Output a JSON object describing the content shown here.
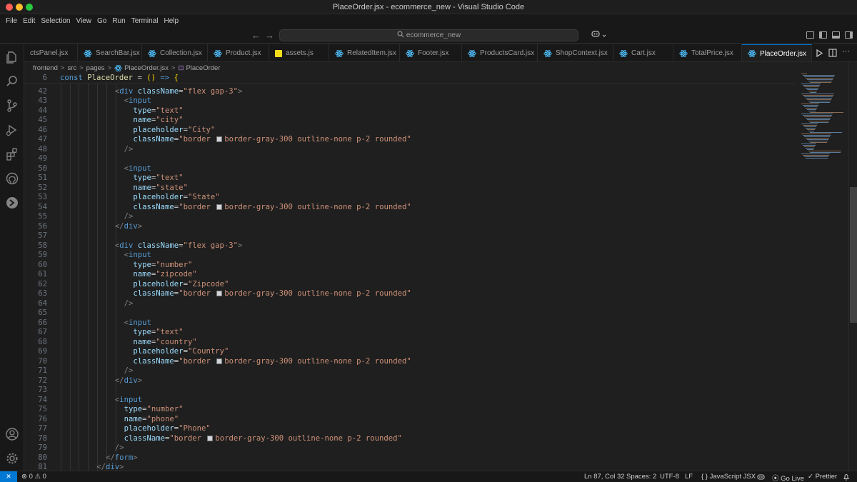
{
  "window": {
    "title": "PlaceOrder.jsx - ecommerce_new - Visual Studio Code"
  },
  "menu": [
    "File",
    "Edit",
    "Selection",
    "View",
    "Go",
    "Run",
    "Terminal",
    "Help"
  ],
  "command_center": {
    "label": "ecommerce_new",
    "back": "←",
    "forward": "→"
  },
  "tabs": [
    {
      "label": "ctsPanel.jsx",
      "icon": "react-icon"
    },
    {
      "label": "SearchBar.jsx",
      "icon": "react-icon"
    },
    {
      "label": "Collection.jsx",
      "icon": "react-icon"
    },
    {
      "label": "Product.jsx",
      "icon": "react-icon"
    },
    {
      "label": "assets.js",
      "icon": "js-icon"
    },
    {
      "label": "RelatedItem.jsx",
      "icon": "react-icon"
    },
    {
      "label": "Footer.jsx",
      "icon": "react-icon"
    },
    {
      "label": "ProductsCard.jsx",
      "icon": "react-icon"
    },
    {
      "label": "ShopContext.jsx",
      "icon": "react-icon"
    },
    {
      "label": "Cart.jsx",
      "icon": "react-icon"
    },
    {
      "label": "TotalPrice.jsx",
      "icon": "react-icon"
    },
    {
      "label": "PlaceOrder.jsx",
      "icon": "react-icon",
      "active": true,
      "close": "✕"
    }
  ],
  "breadcrumb": [
    "frontend",
    "src",
    "pages",
    "PlaceOrder.jsx",
    "PlaceOrder"
  ],
  "editor": {
    "sticky_line": {
      "number": "6",
      "tokens": [
        [
          "kw",
          "const "
        ],
        [
          "fn",
          "PlaceOrder"
        ],
        [
          "",
          "  = "
        ],
        [
          "brace",
          "()"
        ],
        [
          "kw",
          " =>"
        ],
        [
          "brace",
          " {"
        ]
      ]
    },
    "lines": [
      {
        "n": "42",
        "indent": 6,
        "tokens": [
          [
            "punc",
            "<"
          ],
          [
            "tag",
            "div"
          ],
          [
            "attr",
            " className"
          ],
          [
            "",
            "="
          ],
          [
            "str",
            "\"flex gap-3\""
          ],
          [
            "punc",
            ">"
          ]
        ]
      },
      {
        "n": "43",
        "indent": 7,
        "tokens": [
          [
            "punc",
            "<"
          ],
          [
            "tag",
            "input"
          ]
        ]
      },
      {
        "n": "44",
        "indent": 8,
        "tokens": [
          [
            "attr",
            "type"
          ],
          [
            "",
            "="
          ],
          [
            "str",
            "\"text\""
          ]
        ]
      },
      {
        "n": "45",
        "indent": 8,
        "tokens": [
          [
            "attr",
            "name"
          ],
          [
            "",
            "="
          ],
          [
            "str",
            "\"city\""
          ]
        ]
      },
      {
        "n": "46",
        "indent": 8,
        "tokens": [
          [
            "attr",
            "placeholder"
          ],
          [
            "",
            "="
          ],
          [
            "str",
            "\"City\""
          ]
        ]
      },
      {
        "n": "47",
        "indent": 8,
        "tokens": [
          [
            "attr",
            "className"
          ],
          [
            "",
            "="
          ],
          [
            "str",
            "\"border "
          ],
          [
            "swatch",
            ""
          ],
          [
            "str",
            "border-gray-300 outline-none p-2 rounded\""
          ]
        ]
      },
      {
        "n": "48",
        "indent": 7,
        "tokens": [
          [
            "punc",
            "/>"
          ]
        ]
      },
      {
        "n": "49",
        "indent": 0,
        "tokens": []
      },
      {
        "n": "50",
        "indent": 7,
        "tokens": [
          [
            "punc",
            "<"
          ],
          [
            "tag",
            "input"
          ]
        ]
      },
      {
        "n": "51",
        "indent": 8,
        "tokens": [
          [
            "attr",
            "type"
          ],
          [
            "",
            "="
          ],
          [
            "str",
            "\"text\""
          ]
        ]
      },
      {
        "n": "52",
        "indent": 8,
        "tokens": [
          [
            "attr",
            "name"
          ],
          [
            "",
            "="
          ],
          [
            "str",
            "\"state\""
          ]
        ]
      },
      {
        "n": "53",
        "indent": 8,
        "tokens": [
          [
            "attr",
            "placeholder"
          ],
          [
            "",
            "="
          ],
          [
            "str",
            "\"State\""
          ]
        ]
      },
      {
        "n": "54",
        "indent": 8,
        "tokens": [
          [
            "attr",
            "className"
          ],
          [
            "",
            "="
          ],
          [
            "str",
            "\"border "
          ],
          [
            "swatch",
            ""
          ],
          [
            "str",
            "border-gray-300 outline-none p-2 rounded\""
          ]
        ]
      },
      {
        "n": "55",
        "indent": 7,
        "tokens": [
          [
            "punc",
            "/>"
          ]
        ]
      },
      {
        "n": "56",
        "indent": 6,
        "tokens": [
          [
            "punc",
            "</"
          ],
          [
            "tag",
            "div"
          ],
          [
            "punc",
            ">"
          ]
        ]
      },
      {
        "n": "57",
        "indent": 0,
        "tokens": []
      },
      {
        "n": "58",
        "indent": 6,
        "tokens": [
          [
            "punc",
            "<"
          ],
          [
            "tag",
            "div"
          ],
          [
            "attr",
            " className"
          ],
          [
            "",
            "="
          ],
          [
            "str",
            "\"flex gap-3\""
          ],
          [
            "punc",
            ">"
          ]
        ]
      },
      {
        "n": "59",
        "indent": 7,
        "tokens": [
          [
            "punc",
            "<"
          ],
          [
            "tag",
            "input"
          ]
        ]
      },
      {
        "n": "60",
        "indent": 8,
        "tokens": [
          [
            "attr",
            "type"
          ],
          [
            "",
            "="
          ],
          [
            "str",
            "\"number\""
          ]
        ]
      },
      {
        "n": "61",
        "indent": 8,
        "tokens": [
          [
            "attr",
            "name"
          ],
          [
            "",
            "="
          ],
          [
            "str",
            "\"zipcode\""
          ]
        ]
      },
      {
        "n": "62",
        "indent": 8,
        "tokens": [
          [
            "attr",
            "placeholder"
          ],
          [
            "",
            "="
          ],
          [
            "str",
            "\"Zipcode\""
          ]
        ]
      },
      {
        "n": "63",
        "indent": 8,
        "tokens": [
          [
            "attr",
            "className"
          ],
          [
            "",
            "="
          ],
          [
            "str",
            "\"border "
          ],
          [
            "swatch",
            ""
          ],
          [
            "str",
            "border-gray-300 outline-none p-2 rounded\""
          ]
        ]
      },
      {
        "n": "64",
        "indent": 7,
        "tokens": [
          [
            "punc",
            "/>"
          ]
        ]
      },
      {
        "n": "65",
        "indent": 0,
        "tokens": []
      },
      {
        "n": "66",
        "indent": 7,
        "tokens": [
          [
            "punc",
            "<"
          ],
          [
            "tag",
            "input"
          ]
        ]
      },
      {
        "n": "67",
        "indent": 8,
        "tokens": [
          [
            "attr",
            "type"
          ],
          [
            "",
            "="
          ],
          [
            "str",
            "\"text\""
          ]
        ]
      },
      {
        "n": "68",
        "indent": 8,
        "tokens": [
          [
            "attr",
            "name"
          ],
          [
            "",
            "="
          ],
          [
            "str",
            "\"country\""
          ]
        ]
      },
      {
        "n": "69",
        "indent": 8,
        "tokens": [
          [
            "attr",
            "placeholder"
          ],
          [
            "",
            "="
          ],
          [
            "str",
            "\"Country\""
          ]
        ]
      },
      {
        "n": "70",
        "indent": 8,
        "tokens": [
          [
            "attr",
            "className"
          ],
          [
            "",
            "="
          ],
          [
            "str",
            "\"border "
          ],
          [
            "swatch",
            ""
          ],
          [
            "str",
            "border-gray-300 outline-none p-2 rounded\""
          ]
        ]
      },
      {
        "n": "71",
        "indent": 7,
        "tokens": [
          [
            "punc",
            "/>"
          ]
        ]
      },
      {
        "n": "72",
        "indent": 6,
        "tokens": [
          [
            "punc",
            "</"
          ],
          [
            "tag",
            "div"
          ],
          [
            "punc",
            ">"
          ]
        ]
      },
      {
        "n": "73",
        "indent": 0,
        "tokens": []
      },
      {
        "n": "74",
        "indent": 6,
        "tokens": [
          [
            "punc",
            "<"
          ],
          [
            "tag",
            "input"
          ]
        ]
      },
      {
        "n": "75",
        "indent": 7,
        "tokens": [
          [
            "attr",
            "type"
          ],
          [
            "",
            "="
          ],
          [
            "str",
            "\"number\""
          ]
        ]
      },
      {
        "n": "76",
        "indent": 7,
        "tokens": [
          [
            "attr",
            "name"
          ],
          [
            "",
            "="
          ],
          [
            "str",
            "\"phone\""
          ]
        ]
      },
      {
        "n": "77",
        "indent": 7,
        "tokens": [
          [
            "attr",
            "placeholder"
          ],
          [
            "",
            "="
          ],
          [
            "str",
            "\"Phone\""
          ]
        ]
      },
      {
        "n": "78",
        "indent": 7,
        "tokens": [
          [
            "attr",
            "className"
          ],
          [
            "",
            "="
          ],
          [
            "str",
            "\"border "
          ],
          [
            "swatch",
            ""
          ],
          [
            "str",
            "border-gray-300 outline-none p-2 rounded\""
          ]
        ]
      },
      {
        "n": "79",
        "indent": 6,
        "tokens": [
          [
            "punc",
            "/>"
          ]
        ]
      },
      {
        "n": "80",
        "indent": 5,
        "tokens": [
          [
            "punc",
            "</"
          ],
          [
            "tag",
            "form"
          ],
          [
            "punc",
            ">"
          ]
        ]
      },
      {
        "n": "81",
        "indent": 4,
        "tokens": [
          [
            "punc",
            "</"
          ],
          [
            "tag",
            "div"
          ],
          [
            "punc",
            ">"
          ]
        ]
      }
    ]
  },
  "statusbar": {
    "remote": "✕",
    "problems": "⊗ 0 ⚠ 0",
    "position": "Ln 87, Col 32",
    "spaces": "Spaces: 2",
    "encoding": "UTF-8",
    "eol": "LF",
    "language": "{ } JavaScript JSX",
    "golive": "Go Live",
    "prettier": "✓ Prettier",
    "bell": "🔔"
  },
  "colors": {
    "accent": "#0078d4",
    "react": "#4fc1ff",
    "js": "#f5de19"
  }
}
